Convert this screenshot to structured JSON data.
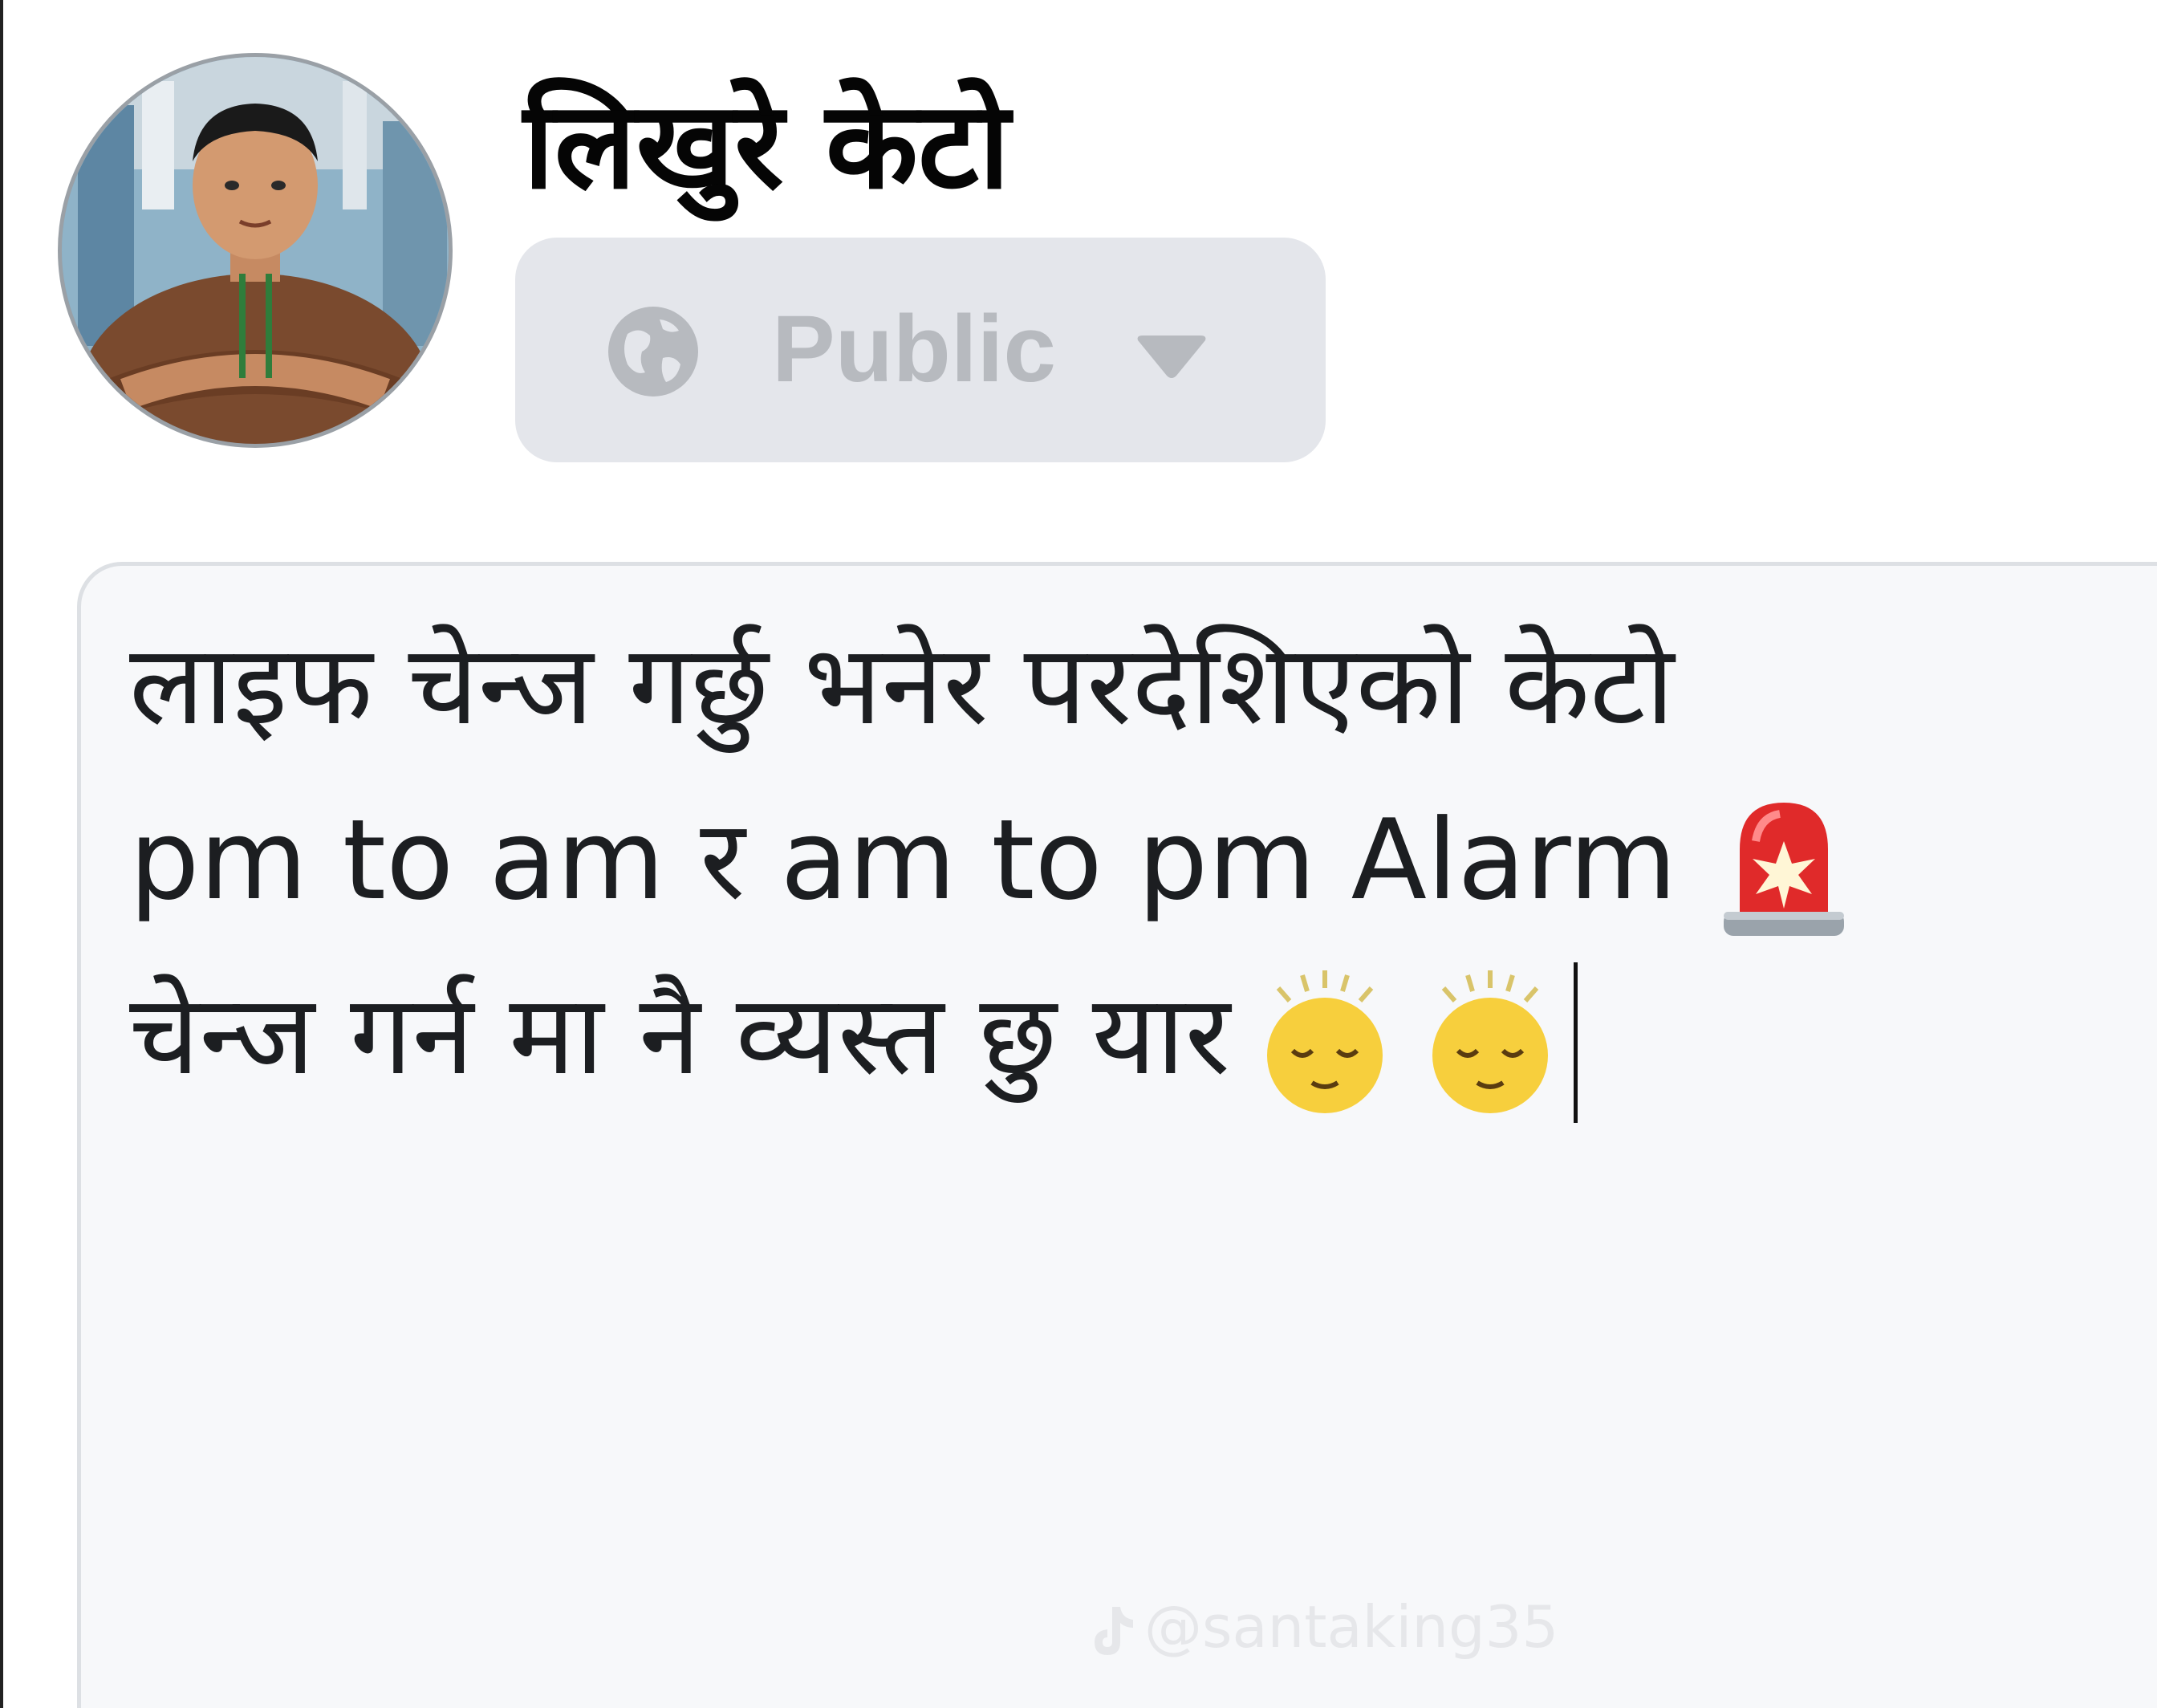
{
  "post_header": {
    "author_name": "लिखुरे केटो",
    "audience": {
      "label": "Public",
      "icon": "globe-icon",
      "dropdown_icon": "caret-down-icon"
    }
  },
  "composer": {
    "text_lines": [
      "लाइफ चेन्ज गर्छु भनेर परदेशिएको केटो",
      "pm to am र am to pm Alarm",
      "चेन्ज गर्न मा नै व्यस्त छु यार"
    ],
    "emojis": [
      "police-car-light-emoji",
      "relieved-face-emoji",
      "relieved-face-emoji"
    ]
  },
  "watermark": {
    "icon": "tiktok-logo-icon",
    "text": "@santaking35"
  },
  "colors": {
    "audience_bg": "#e4e6eb",
    "audience_text": "#b7babf",
    "composer_bg": "#f7f8fa",
    "text": "#1c1e21"
  }
}
